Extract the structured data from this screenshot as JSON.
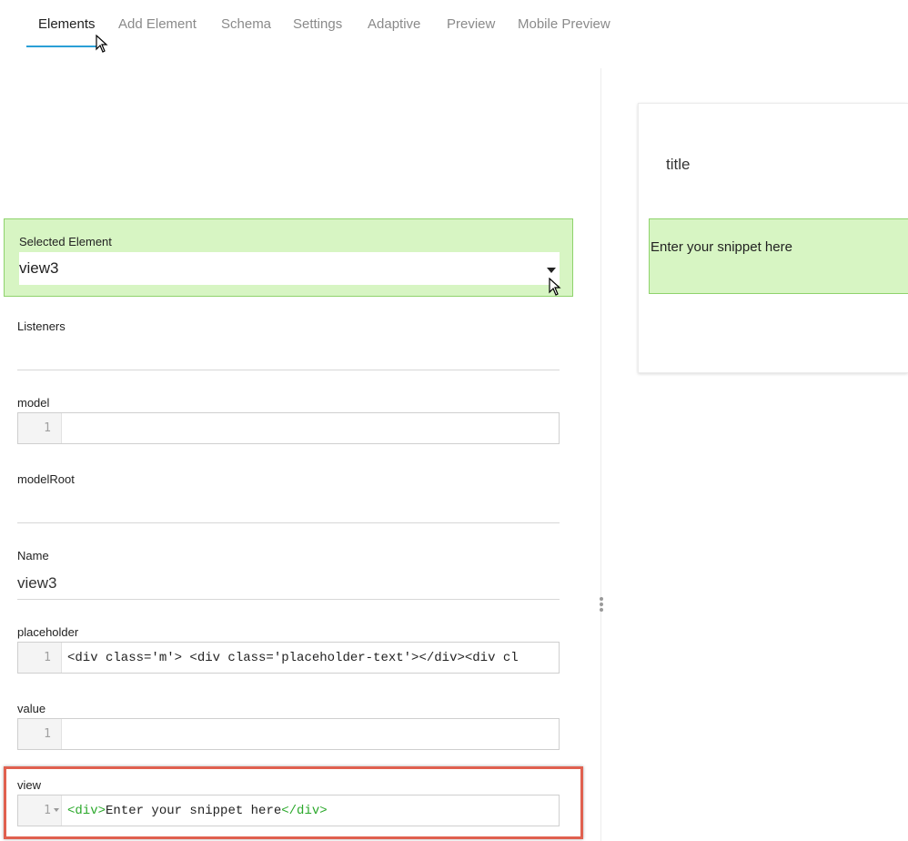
{
  "tabs": [
    {
      "label": "Elements",
      "active": true
    },
    {
      "label": "Add Element"
    },
    {
      "label": "Schema"
    },
    {
      "label": "Settings"
    },
    {
      "label": "Adaptive"
    },
    {
      "label": "Preview"
    },
    {
      "label": "Mobile Preview"
    }
  ],
  "selected_element": {
    "label": "Selected Element",
    "value": "view3"
  },
  "fields": {
    "listeners": {
      "label": "Listeners"
    },
    "model": {
      "label": "model",
      "line_number": "1",
      "code": ""
    },
    "model_root": {
      "label": "modelRoot"
    },
    "name": {
      "label": "Name",
      "value": "view3"
    },
    "placeholder": {
      "label": "placeholder",
      "line_number": "1",
      "code": "<div class='m'> <div class='placeholder-text'></div><div cl"
    },
    "value": {
      "label": "value",
      "line_number": "1",
      "code": ""
    },
    "view": {
      "label": "view",
      "line_number": "1",
      "code_open_tag": "<div>",
      "code_text": "Enter your snippet here",
      "code_close_tag": "</div>"
    }
  },
  "preview": {
    "title": "title",
    "snippet": "Enter your snippet here"
  },
  "colors": {
    "tab_underline": "#2a9fd6",
    "selected_bg": "#d7f5c3",
    "selected_border": "#8fd36c",
    "highlight_border": "#e0604f",
    "code_tag": "#2aa82a"
  },
  "icons": [
    "dropdown-arrow-icon",
    "mouse-cursor-icon",
    "drag-handle-icon",
    "fold-arrow-icon"
  ]
}
